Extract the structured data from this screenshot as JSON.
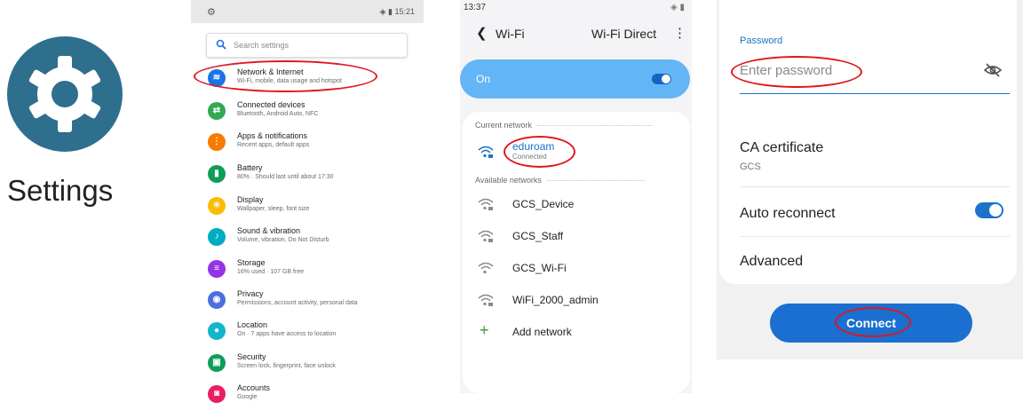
{
  "panel1": {
    "app_label": "Settings",
    "icon": "gear-icon"
  },
  "panel2": {
    "status_time": "15:21",
    "search_placeholder": "Search settings",
    "items": [
      {
        "title": "Network & Internet",
        "subtitle": "Wi-Fi, mobile, data usage and hotspot",
        "icon": "wifi-icon",
        "color": "#1a73e8"
      },
      {
        "title": "Connected devices",
        "subtitle": "Bluetooth, Android Auto, NFC",
        "icon": "devices-icon",
        "color": "#34a853"
      },
      {
        "title": "Apps & notifications",
        "subtitle": "Recent apps, default apps",
        "icon": "apps-icon",
        "color": "#f57c00"
      },
      {
        "title": "Battery",
        "subtitle": "80% · Should last until about 17:30",
        "icon": "battery-icon",
        "color": "#0f9d58"
      },
      {
        "title": "Display",
        "subtitle": "Wallpaper, sleep, font size",
        "icon": "display-icon",
        "color": "#fbbc04"
      },
      {
        "title": "Sound & vibration",
        "subtitle": "Volume, vibration, Do Not Disturb",
        "icon": "sound-icon",
        "color": "#00acc1"
      },
      {
        "title": "Storage",
        "subtitle": "16% used · 107 GB free",
        "icon": "storage-icon",
        "color": "#9334e6"
      },
      {
        "title": "Privacy",
        "subtitle": "Permissions, account activity, personal data",
        "icon": "privacy-icon",
        "color": "#4a6ee0"
      },
      {
        "title": "Location",
        "subtitle": "On · 7 apps have access to location",
        "icon": "location-icon",
        "color": "#12b5cb"
      },
      {
        "title": "Security",
        "subtitle": "Screen lock, fingerprint, face unlock",
        "icon": "lock-icon",
        "color": "#0f9d58"
      },
      {
        "title": "Accounts",
        "subtitle": "Google",
        "icon": "accounts-icon",
        "color": "#e91e63"
      }
    ]
  },
  "panel3": {
    "status_time": "13:37",
    "back_label": "Wi-Fi",
    "wifi_direct": "Wi-Fi Direct",
    "on_label": "On",
    "current_network_label": "Current network",
    "current_network": {
      "name": "eduroam",
      "status": "Connected"
    },
    "available_networks_label": "Available networks",
    "networks": [
      {
        "name": "GCS_Device",
        "locked": true
      },
      {
        "name": "GCS_Staff",
        "locked": true
      },
      {
        "name": "GCS_Wi-Fi",
        "locked": false
      },
      {
        "name": "WiFi_2000_admin",
        "locked": true
      }
    ],
    "add_network": "Add network"
  },
  "panel4": {
    "password_label": "Password",
    "password_placeholder": "Enter password",
    "ca_title": "CA certificate",
    "ca_value": "GCS",
    "auto_reconnect": "Auto reconnect",
    "advanced": "Advanced",
    "connect": "Connect"
  },
  "colors": {
    "accent": "#1a73c8",
    "annotation": "#e0161e",
    "toggle_on": "#1a73c8"
  }
}
